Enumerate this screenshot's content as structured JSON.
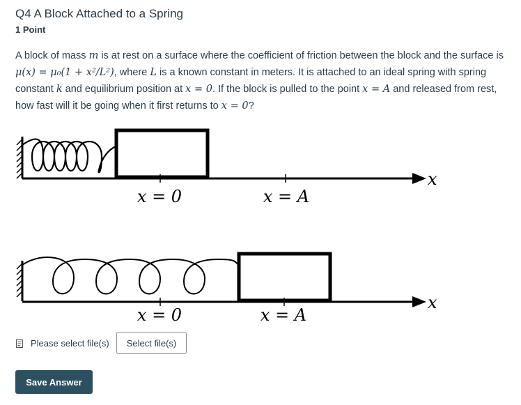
{
  "question": {
    "title": "Q4 A Block Attached to a Spring",
    "points": "1 Point",
    "text": {
      "p1": "A block of mass ",
      "m": "m",
      "p2": " is at rest on a surface where the coefficient of friction between the block and the surface is ",
      "mu_expr": "μ(x) = μ₀(1 + x²/L²)",
      "p3": ", where ",
      "L": "L",
      "p4": " is a known constant in meters. It is attached to an ideal spring with spring constant ",
      "k": "k",
      "p5": " and equilibrium position at ",
      "eq": "x = 0",
      "p6": ". If the block is pulled to the point ",
      "pt": "x = A",
      "p7": " and released from  rest, how fast will it be going when it first returns to ",
      "ret": "x = 0",
      "p8": "?"
    }
  },
  "figure": {
    "top_labels": {
      "zero": "x = 0",
      "a": "x = A",
      "axis": "x"
    },
    "bottom_labels": {
      "zero": "x = 0",
      "a": "x = A",
      "axis": "x"
    }
  },
  "upload": {
    "icon": "file-icon",
    "label": "Please select file(s)",
    "button": "Select file(s)"
  },
  "save": {
    "label": "Save Answer"
  },
  "colors": {
    "save_bg": "#2d5061",
    "text": "#2d3b45"
  }
}
